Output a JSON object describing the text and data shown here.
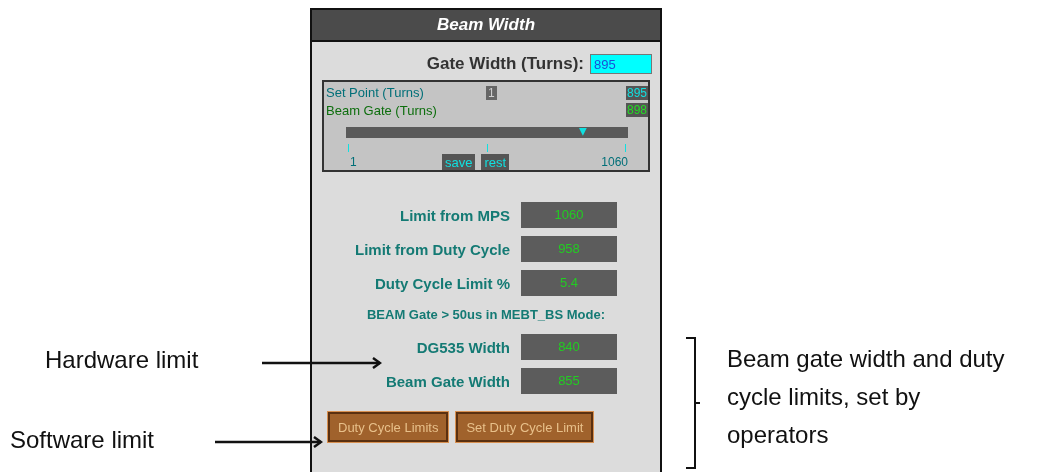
{
  "panel": {
    "title": "Beam Width",
    "gate_width": {
      "label": "Gate Width (Turns):",
      "value": "895"
    },
    "slider": {
      "set_point_label": "Set Point (Turns)",
      "set_point_marker": "1",
      "set_point_value": "895",
      "beam_gate_label": "Beam Gate (Turns)",
      "beam_gate_value": "898",
      "level": 0.84,
      "scale_min": "1",
      "scale_max": "1060",
      "buttons": [
        "save",
        "rest"
      ]
    },
    "rows": [
      {
        "kind": "readout",
        "label": "Limit from MPS",
        "value": "1060"
      },
      {
        "kind": "readout",
        "label": "Limit from Duty Cycle",
        "value": "958"
      },
      {
        "kind": "readout",
        "label": "Duty Cycle Limit %",
        "value": "5.4"
      },
      {
        "kind": "note",
        "label": "BEAM Gate > 50us in MEBT_BS Mode:"
      },
      {
        "kind": "readout",
        "label": "DG535 Width",
        "value": "840"
      },
      {
        "kind": "readout",
        "label": "Beam Gate Width",
        "value": "855"
      }
    ],
    "buttons": [
      "Duty Cycle Limits",
      "Set Duty Cycle Limit"
    ]
  },
  "annotations": [
    {
      "text": "Hardware limit"
    },
    {
      "text": "Software limit"
    }
  ],
  "bracket_note": "Beam gate width and duty cycle limits, set by operators"
}
